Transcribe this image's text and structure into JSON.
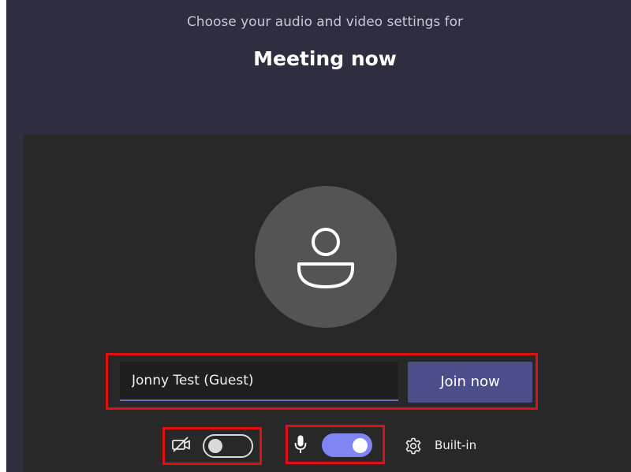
{
  "header": {
    "subtitle": "Choose your audio and video settings for",
    "meeting_title": "Meeting now"
  },
  "join": {
    "name_value": "Jonny Test (Guest)",
    "join_label": "Join now"
  },
  "devices": {
    "camera": {
      "icon": "camera-off-icon",
      "enabled": false
    },
    "microphone": {
      "icon": "microphone-icon",
      "enabled": true
    },
    "device_settings_icon": "gear-icon",
    "device_label": "Built-in"
  },
  "colors": {
    "background": "#2f2e40",
    "stage": "#282828",
    "accent": "#7f85f5",
    "join_button": "#4b4e8a",
    "highlight": "#e10f12"
  }
}
